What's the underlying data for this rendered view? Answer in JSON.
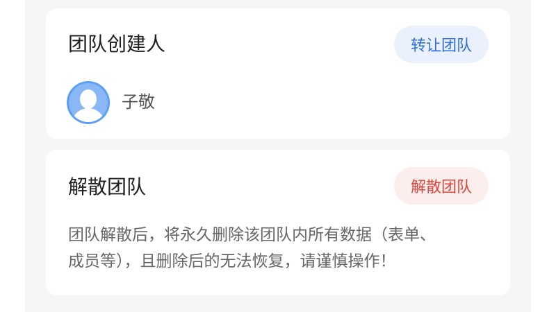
{
  "creator_card": {
    "title": "团队创建人",
    "transfer_button": "转让团队",
    "creator_name": "子敬"
  },
  "disband_card": {
    "title": "解散团队",
    "disband_button": "解散团队",
    "description_line1": "团队解散后，将永久删除该团队内所有数据（表单、",
    "description_line2": "成员等），且删除后的无法恢复，请谨慎操作！"
  },
  "colors": {
    "accent_blue": "#2f6fe0",
    "danger_red": "#e0443a",
    "background": "#f5f6f8"
  },
  "icons": {
    "avatar": "user-avatar-icon"
  }
}
